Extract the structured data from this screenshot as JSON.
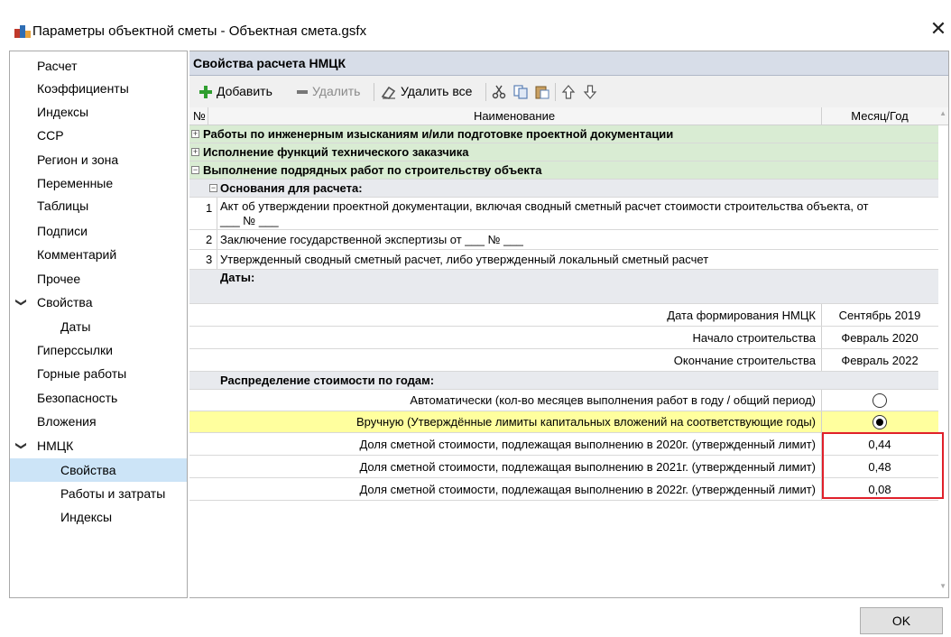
{
  "window": {
    "title": "Параметры объектной сметы - Объектная смета.gsfx",
    "close_glyph": "✕"
  },
  "sidebar": {
    "items": [
      {
        "label": "Расчет"
      },
      {
        "label": "Коэффициенты"
      },
      {
        "label": "Индексы"
      },
      {
        "label": "ССР"
      },
      {
        "label": "Регион и зона"
      },
      {
        "label": "Переменные"
      },
      {
        "label": "Таблицы"
      },
      {
        "label": "Подписи"
      },
      {
        "label": "Комментарий"
      },
      {
        "label": "Прочее"
      },
      {
        "label": "Свойства",
        "chevron": "❯"
      },
      {
        "label": "Даты"
      },
      {
        "label": "Гиперссылки"
      },
      {
        "label": "Горные работы"
      },
      {
        "label": "Безопасность"
      },
      {
        "label": "Вложения"
      },
      {
        "label": "НМЦК",
        "chevron": "❯"
      },
      {
        "label": "Свойства"
      },
      {
        "label": "Работы и затраты"
      },
      {
        "label": "Индексы"
      }
    ]
  },
  "panel": {
    "header": "Свойства расчета НМЦК"
  },
  "toolbar": {
    "add": "Добавить",
    "delete": "Удалить",
    "delete_all": "Удалить все"
  },
  "grid": {
    "columns": {
      "num": "№",
      "name": "Наименование",
      "month_year": "Месяц/Год"
    },
    "groups": {
      "g1": "Работы по инженерным изысканиям и/или подготовке проектной документации",
      "g2": "Исполнение функций технического заказчика",
      "g3": "Выполнение подрядных работ по строительству объекта"
    },
    "bases_header": "Основания для расчета:",
    "bases": [
      {
        "num": "1",
        "line1": "Акт об утверждении проектной документации, включая сводный сметный расчет стоимости строительства объекта, от",
        "line2": "___ № ___"
      },
      {
        "num": "2",
        "line1": "Заключение государственной экспертизы от ___ № ___"
      },
      {
        "num": "3",
        "line1": "Утвержденный сводный сметный расчет, либо утвержденный локальный сметный расчет"
      }
    ],
    "dates_header": "Даты:",
    "dates": [
      {
        "label": "Дата формирования НМЦК",
        "value": "Сентябрь 2019"
      },
      {
        "label": "Начало строительства",
        "value": "Февраль 2020"
      },
      {
        "label": "Окончание строительства",
        "value": "Февраль 2022"
      }
    ],
    "distribution_header": "Распределение стоимости по годам:",
    "auto_label": "Автоматически (кол-во месяцев выполнения работ в году / общий период)",
    "manual_label": "Вручную (Утверждённые лимиты капитальных вложений на соответствующие годы)",
    "shares": [
      {
        "label": "Доля сметной стоимости, подлежащая выполнению в 2020г. (утвержденный лимит)",
        "value": "0,44"
      },
      {
        "label": "Доля сметной стоимости, подлежащая выполнению в 2021г. (утвержденный лимит)",
        "value": "0,48"
      },
      {
        "label": "Доля сметной стоимости, подлежащая выполнению в 2022г. (утвержденный лимит)",
        "value": "0,08"
      }
    ]
  },
  "buttons": {
    "ok": "OK"
  },
  "colors": {
    "group_row": "#d9ecd3",
    "section_row": "#e8eaee",
    "highlight_row": "#ffff9e",
    "selection": "#cce4f7",
    "annotation_box": "#e0202a"
  }
}
